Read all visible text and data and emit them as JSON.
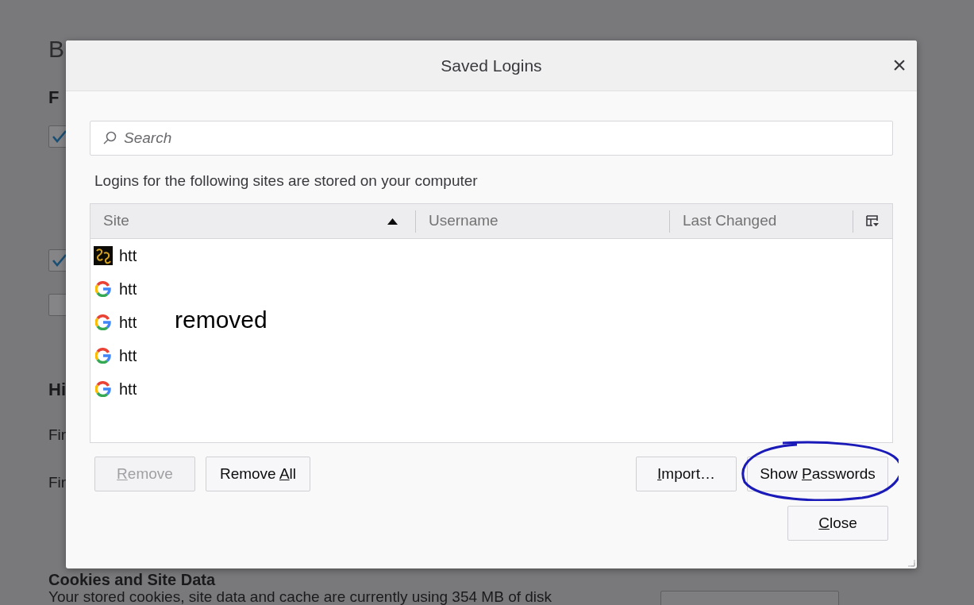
{
  "background": {
    "title": "B",
    "sections": [
      {
        "kind": "heading",
        "text": "F"
      },
      {
        "kind": "checkbox",
        "checked": true
      },
      {
        "kind": "checkbox",
        "checked": true
      },
      {
        "kind": "checkbox",
        "checked": false
      },
      {
        "kind": "heading",
        "text": "Hi"
      },
      {
        "kind": "text",
        "text": "Fir"
      },
      {
        "kind": "text",
        "text": "Fir"
      },
      {
        "kind": "heading",
        "text": "Cookies and Site Data"
      },
      {
        "kind": "text",
        "text": "Your stored cookies, site data and cache are currently using 354 MB of disk"
      }
    ]
  },
  "dialog": {
    "title": "Saved Logins",
    "close_icon": "×",
    "search": {
      "placeholder": "Search"
    },
    "intro": "Logins for the following sites are stored on your computer",
    "table": {
      "columns": [
        {
          "label": "Site",
          "sorted": true
        },
        {
          "label": "Username",
          "sorted": false
        },
        {
          "label": "Last Changed",
          "sorted": false
        }
      ],
      "rows": [
        {
          "site": "htt",
          "kind": "dark"
        },
        {
          "site": "htt",
          "kind": "google"
        },
        {
          "site": "htt",
          "kind": "google"
        },
        {
          "site": "htt",
          "kind": "google"
        },
        {
          "site": "htt",
          "kind": "google"
        }
      ]
    },
    "left_buttons": [
      {
        "key": "R",
        "after": "emove",
        "disabled": true
      },
      {
        "before": "Remove ",
        "key": "A",
        "after": "ll",
        "disabled": false
      }
    ],
    "right_buttons": [
      {
        "key": "I",
        "after": "mport…",
        "disabled": false
      },
      {
        "before": "Show ",
        "key": "P",
        "after": "asswords",
        "disabled": false
      }
    ],
    "close_button": {
      "key": "C",
      "after": "lose",
      "disabled": false
    }
  },
  "annotation": {
    "text": "removed"
  }
}
